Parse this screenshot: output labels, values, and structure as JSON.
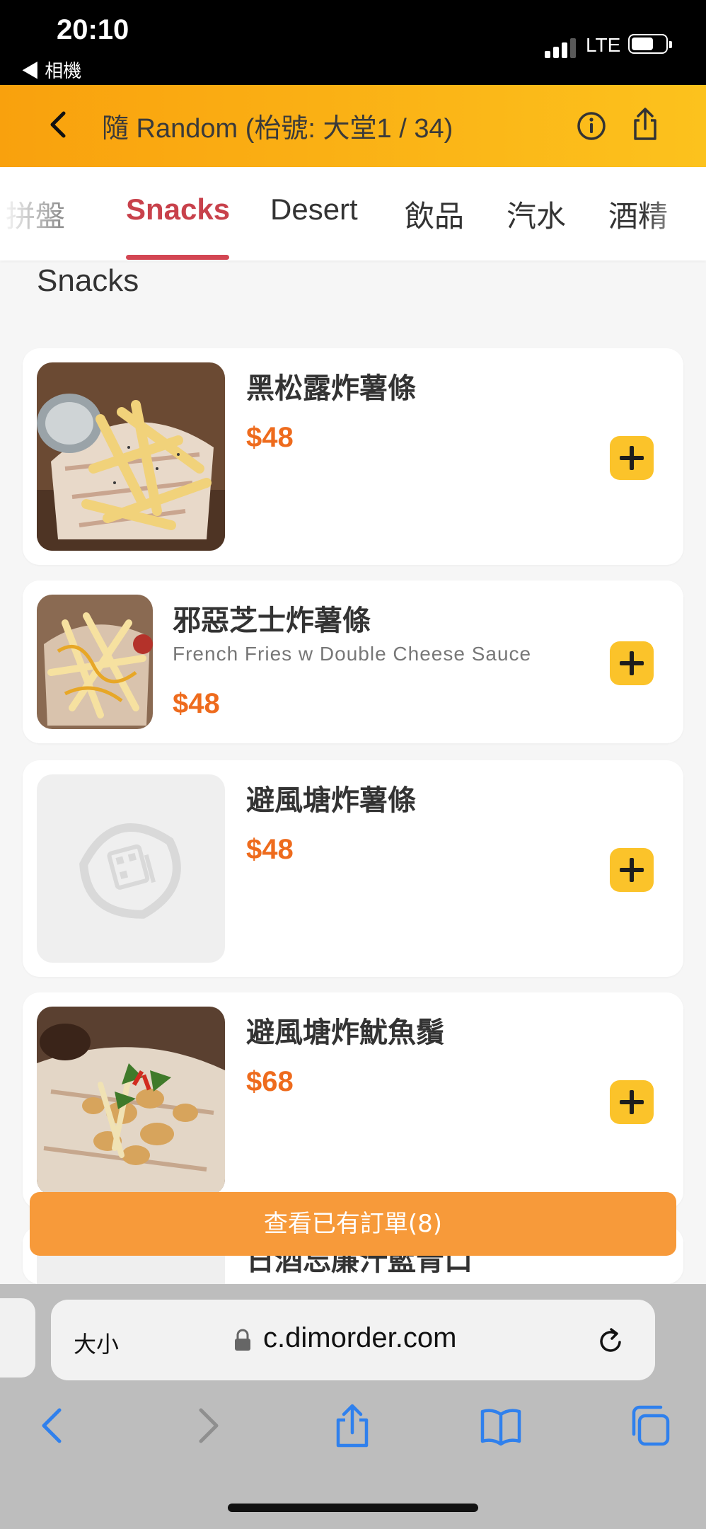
{
  "status_bar": {
    "time": "20:10",
    "back_app": "◀ 相機",
    "network": "LTE"
  },
  "header": {
    "title": "隨 Random (枱號: 大堂1 / 34)"
  },
  "tabs": [
    {
      "label": "拼盤"
    },
    {
      "label": "Snacks"
    },
    {
      "label": "Desert"
    },
    {
      "label": "飲品"
    },
    {
      "label": "汽水"
    },
    {
      "label": "酒精"
    }
  ],
  "active_tab": "Snacks",
  "section": {
    "title": "Snacks"
  },
  "items": [
    {
      "name": "黑松露炸薯條",
      "subtitle": "",
      "price": "$48",
      "image": "truffle-fries-photo"
    },
    {
      "name": "邪惡芝士炸薯條",
      "subtitle": "French Fries w Double Cheese Sauce",
      "price": "$48",
      "image": "cheese-fries-photo"
    },
    {
      "name": "避風塘炸薯條",
      "subtitle": "",
      "price": "$48",
      "image": "placeholder-logo"
    },
    {
      "name": "避風塘炸魷魚鬚",
      "subtitle": "",
      "price": "$68",
      "image": "squid-tentacles-photo"
    },
    {
      "name": "日酒忘廉汁藍青口",
      "subtitle": "",
      "price": "",
      "image": "partially-hidden"
    }
  ],
  "order_button": {
    "label": "查看已有訂單(8)"
  },
  "browser": {
    "text_size": "大小",
    "url": "c.dimorder.com"
  },
  "colors": {
    "header_start": "#f9a10d",
    "header_end": "#fcc21d",
    "active_tab": "#c8414b",
    "price": "#ee6b1d",
    "add_button": "#fbc32a",
    "order_bar": "#f79a3a",
    "safari_blue": "#2f80ed"
  }
}
